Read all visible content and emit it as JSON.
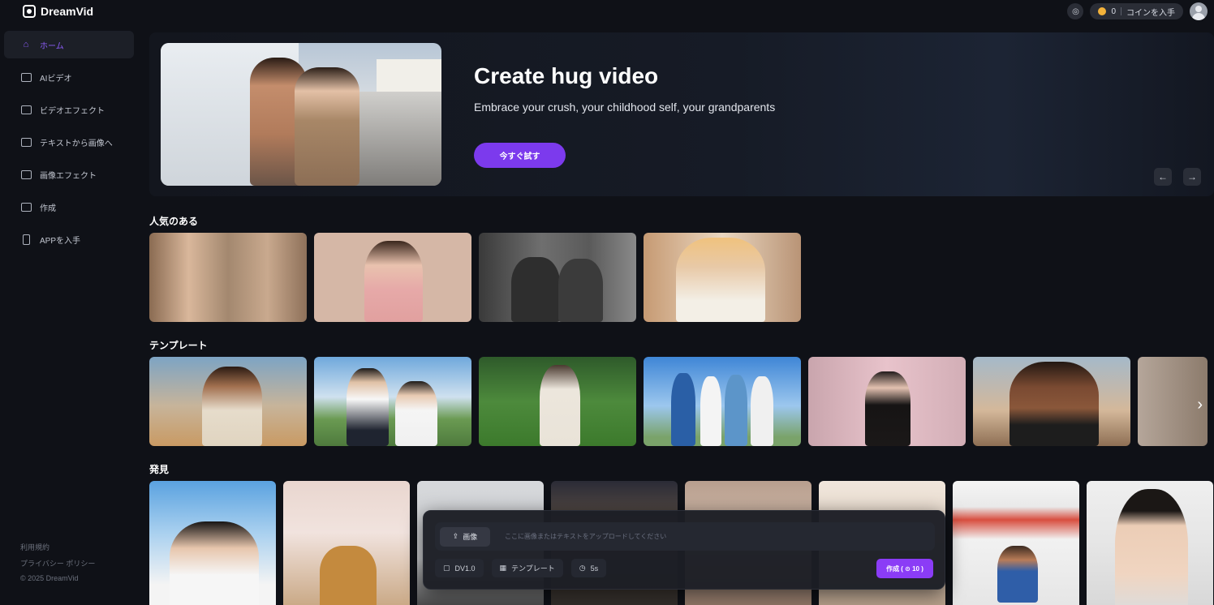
{
  "app": {
    "name": "DreamVid"
  },
  "topbar": {
    "coins": "0",
    "get_coins_label": "コインを入手",
    "ai_icon": "ai-chat-icon"
  },
  "sidebar": {
    "items": [
      {
        "label": "ホーム",
        "icon": "home-icon"
      },
      {
        "label": "AIビデオ",
        "icon": "ai-video-icon"
      },
      {
        "label": "ビデオエフェクト",
        "icon": "video-effect-icon"
      },
      {
        "label": "テキストから画像へ",
        "icon": "text-to-image-icon"
      },
      {
        "label": "画像エフェクト",
        "icon": "image-effect-icon"
      },
      {
        "label": "作成",
        "icon": "create-icon"
      },
      {
        "label": "APPを入手",
        "icon": "phone-icon"
      }
    ],
    "footer": {
      "terms": "利用規約",
      "privacy": "プライバシー ポリシー",
      "copyright": "© 2025 DreamVid"
    }
  },
  "hero": {
    "title": "Create hug video",
    "subtitle": "Embrace your crush, your childhood self, your grandparents",
    "cta": "今すぐ試す",
    "prev": "←",
    "next": "→"
  },
  "sections": {
    "popular": "人気のある",
    "templates": "テンプレート",
    "discover": "発見"
  },
  "prompt": {
    "image_button": "画像",
    "placeholder": "ここに画像またはテキストをアップロードしてください",
    "model": "DV1.0",
    "template": "テンプレート",
    "duration": "5s",
    "create": "作成 ( ⊙ 10 )"
  },
  "colors": {
    "accent": "#7c3aed",
    "background": "#0f1117",
    "coin": "#f3b23a"
  }
}
